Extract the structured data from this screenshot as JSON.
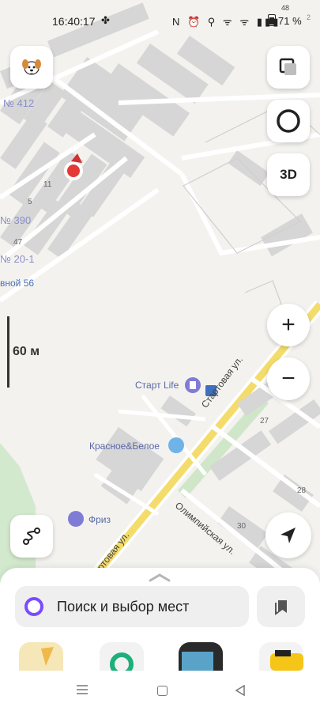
{
  "status_bar": {
    "time": "16:40:17",
    "clover": "✤",
    "icons": "N ⏰ ⚲ ᯤ ᯤ ▮▮▮",
    "battery_percent": "71 %",
    "extra_top": "48",
    "extra_small": "2"
  },
  "map": {
    "labels": {
      "n412": "№ 412",
      "n390": "№ 390",
      "n20_1": "№ 20-1",
      "vnoy56": "вной 56"
    },
    "houses": {
      "h11": "11",
      "h5": "5",
      "h47": "47",
      "h27": "27",
      "h28": "28",
      "h30": "30"
    },
    "pois": {
      "start_life": "Старт Life",
      "krasnoe_beloe": "Красное&Белое",
      "friz": "Фриз"
    },
    "streets": {
      "startovaya_upper": "Стартовая ул.",
      "startovaya_lower": "ртовая ул.",
      "olimpiyskaya": "Олимпийская ул."
    },
    "scale_label": "60 м",
    "colors": {
      "background": "#f3f2ee",
      "building": "#d6d6d6",
      "road": "#ffffff",
      "main_road": "#f4dc6b",
      "green": "#cfe7c8",
      "poi_icon": "#7f7cd6",
      "marker": "#e53935"
    }
  },
  "controls": {
    "layers_icon": "layers-icon",
    "pano_icon": "panorama-icon",
    "three_d_label": "3D",
    "zoom_in_label": "+",
    "zoom_out_label": "−",
    "route_icon": "route-icon",
    "locate_icon": "navigation-arrow-icon",
    "avatar_icon": "dog-avatar-icon"
  },
  "sheet": {
    "search_placeholder": "Поиск и выбор мест",
    "bookmarks_icon": "bookmarks-icon"
  },
  "nav": {
    "menu_icon": "menu-icon",
    "home_icon": "home-icon",
    "back_icon": "back-icon"
  }
}
